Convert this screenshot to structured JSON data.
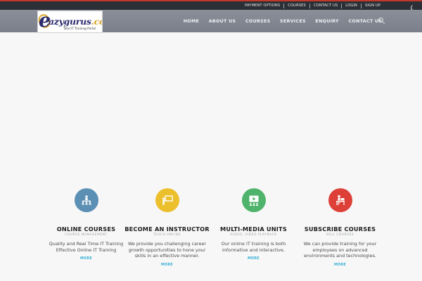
{
  "topbar": {
    "links": [
      "PAYMENT OPTIONS",
      "COURSES",
      "CONTACT US",
      "LOGIN",
      "SIGN UP"
    ]
  },
  "logo": {
    "brand": "azygurus",
    "tld": ".com",
    "tagline": "Total IT Training Portal"
  },
  "nav": {
    "items": [
      "HOME",
      "ABOUT US",
      "COURSES",
      "SERVICES",
      "ENQUIRY",
      "CONTACT US"
    ],
    "active": "HOME"
  },
  "colors": {
    "accent": "#c0392b",
    "topbar": "#2c2f36",
    "navbar": "#828791",
    "link": "#35b0d6"
  },
  "features": [
    {
      "icon": "classroom-icon",
      "color": "#5b8fb3",
      "title": "ONLINE COURSES",
      "subtitle": "COURSE MANAGEMENT",
      "lines": [
        "Quality and Real Time IT Training",
        "Effective Online IT Training"
      ],
      "more": "MORE"
    },
    {
      "icon": "instructor-board-icon",
      "color": "#ecbf2c",
      "title": "BECOME AN INSTRUCTOR",
      "subtitle": "TEACH ONLINE",
      "lines": [
        "We provide you challenging career",
        "growth opportunities to hone your",
        "skills in an effective manner."
      ],
      "more": "MORE"
    },
    {
      "icon": "multimedia-screen-icon",
      "color": "#4fb36b",
      "title": "MULTI-MEDIA UNITS",
      "subtitle": "AUDIO, VIDEO PLAYBACK",
      "lines": [
        "Our online IT training is both",
        "informative and interactive."
      ],
      "more": "MORE"
    },
    {
      "icon": "subscriber-desk-icon",
      "color": "#dd4037",
      "title": "SUBSCRIBE COURSES",
      "subtitle": "SELL COURSES",
      "lines": [
        "We can provide training for your",
        "employees on advanced",
        "environments and technologies."
      ],
      "more": "MORE"
    }
  ]
}
